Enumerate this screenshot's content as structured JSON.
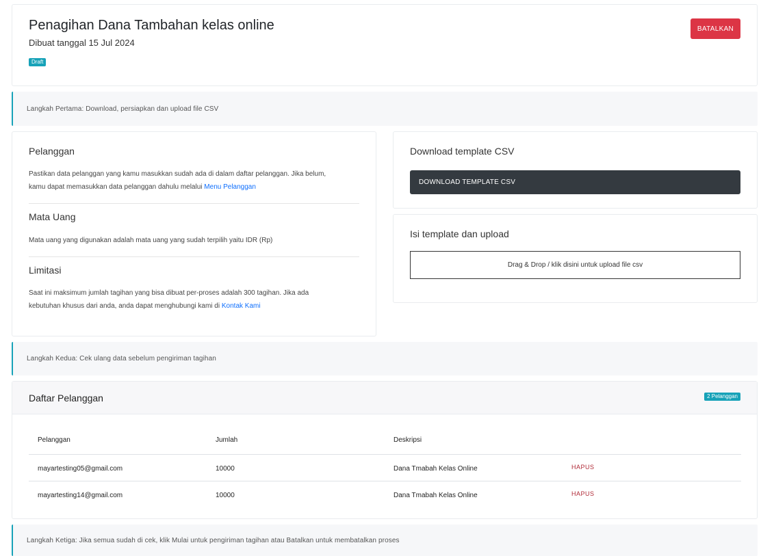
{
  "header": {
    "title": "Penagihan Dana Tambahan kelas online",
    "created": "Dibuat tanggal 15 Jul 2024",
    "status_badge": "Draft",
    "cancel_label": "BATALKAN"
  },
  "steps": {
    "step1": "Langkah Pertama: Download, persiapkan dan upload file CSV",
    "step2": "Langkah Kedua: Cek ulang data sebelum pengiriman tagihan",
    "step3": "Langkah Ketiga: Jika semua sudah di cek, klik Mulai untuk pengiriman tagihan atau Batalkan untuk membatalkan proses"
  },
  "info": {
    "customer_title": "Pelanggan",
    "customer_text_1": "Pastikan data pelanggan yang kamu masukkan sudah ada di dalam daftar pelanggan. Jika belum,",
    "customer_text_2": "kamu dapat memasukkan data pelanggan dahulu melalui",
    "customer_link": "Menu Pelanggan",
    "currency_title": "Mata Uang",
    "currency_text": "Mata uang yang digunakan adalah mata uang yang sudah terpilih yaitu IDR (Rp)",
    "limit_title": "Limitasi",
    "limit_text_1": "Saat ini maksimum jumlah tagihan yang bisa dibuat per-proses adalah 300 tagihan. Jika ada",
    "limit_text_2": "kebutuhan khusus dari anda, anda dapat menghubungi kami di",
    "limit_link": "Kontak Kami"
  },
  "download": {
    "title": "Download template CSV",
    "button_label": "DOWNLOAD TEMPLATE CSV"
  },
  "upload": {
    "title": "Isi template dan upload",
    "dropzone_text": "Drag & Drop / klik disini untuk upload file csv"
  },
  "customers": {
    "title": "Daftar Pelanggan",
    "count_badge": "2 Pelanggan",
    "columns": [
      "Pelanggan",
      "Jumlah",
      "Deskripsi"
    ],
    "rows": [
      {
        "email": "mayartesting05@gmail.com",
        "amount": "10000",
        "description": "Dana Tmabah Kelas Online",
        "action": "HAPUS"
      },
      {
        "email": "mayartesting14@gmail.com",
        "amount": "10000",
        "description": "Dana Tmabah Kelas Online",
        "action": "HAPUS"
      }
    ]
  },
  "colors": {
    "danger": "#dc3545",
    "info": "#17a2b8",
    "dark": "#343a40",
    "link": "#0d6efd"
  }
}
